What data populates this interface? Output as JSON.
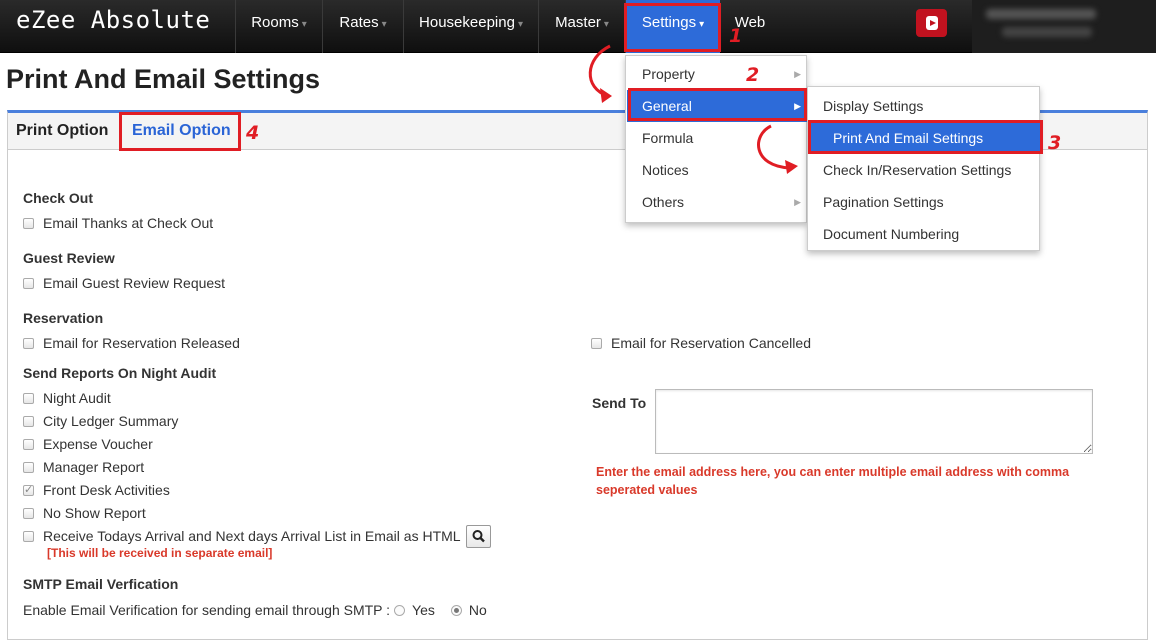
{
  "navbar": {
    "brand": "eZee Absolute",
    "items": [
      {
        "label": "Rooms",
        "caret": "▾"
      },
      {
        "label": "Rates",
        "caret": "▾"
      },
      {
        "label": "Housekeeping",
        "caret": "▾"
      },
      {
        "label": "Master",
        "caret": "▾"
      },
      {
        "label": "Settings",
        "caret": "▾"
      },
      {
        "label": "Web"
      }
    ],
    "youtube_icon": "youtube-icon"
  },
  "page": {
    "title": "Print And Email Settings"
  },
  "tabs": {
    "print": "Print Option",
    "email": "Email Option"
  },
  "checkout": {
    "heading": "Check Out",
    "email_thanks": "Email Thanks at Check Out"
  },
  "guest_review": {
    "heading": "Guest Review",
    "email_request": "Email Guest Review Request"
  },
  "reservation": {
    "heading": "Reservation",
    "released": "Email for Reservation Released",
    "cancelled": "Email for Reservation Cancelled"
  },
  "night_audit": {
    "heading": "Send Reports On Night Audit",
    "items": [
      {
        "label": "Night Audit",
        "checked": false
      },
      {
        "label": "City Ledger Summary",
        "checked": false
      },
      {
        "label": "Expense Voucher",
        "checked": false
      },
      {
        "label": "Manager Report",
        "checked": false
      },
      {
        "label": "Front Desk Activities",
        "checked": true
      },
      {
        "label": "No Show Report",
        "checked": false
      },
      {
        "label": "Receive Todays Arrival and Next days Arrival List in Email as HTML",
        "checked": false
      }
    ],
    "separate_note": "[This will be received in separate email]"
  },
  "send_to": {
    "label": "Send To",
    "value": "",
    "hint": "Enter the email address here, you can enter multiple email address with comma seperated values"
  },
  "smtp": {
    "heading": "SMTP Email Verfication",
    "label": "Enable Email Verification for sending email through SMTP :",
    "yes": "Yes",
    "no": "No",
    "selected": "No"
  },
  "settings_menu": {
    "items": [
      {
        "label": "Property",
        "submenu": true
      },
      {
        "label": "General",
        "submenu": true
      },
      {
        "label": "Formula",
        "submenu": false
      },
      {
        "label": "Notices",
        "submenu": false
      },
      {
        "label": "Others",
        "submenu": true
      }
    ],
    "arrow": "▶"
  },
  "general_submenu": {
    "items": [
      "Display Settings",
      "Print And Email Settings",
      "Check In/Reservation Settings",
      "Pagination Settings",
      "Document Numbering"
    ]
  },
  "annotations": {
    "step1": "1",
    "step2": "2",
    "step3": "3",
    "step4": "4",
    "color": "#e01d24"
  },
  "colors": {
    "accent": "#2d6bd9",
    "warning": "#d9392a"
  }
}
